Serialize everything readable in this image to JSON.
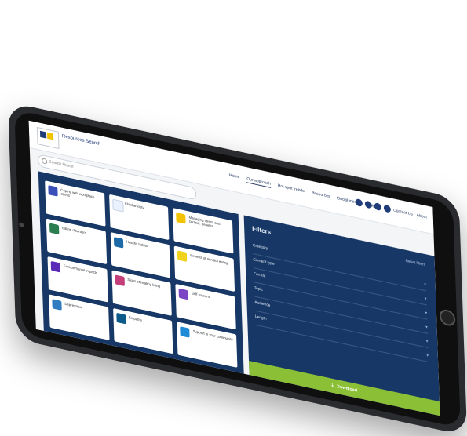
{
  "app": {
    "title": "Resources Search"
  },
  "search": {
    "placeholder": "Search Result"
  },
  "nav": {
    "items": [
      {
        "label": "Home"
      },
      {
        "label": "Our approach"
      },
      {
        "label": "Hot spot trends"
      },
      {
        "label": "Resources"
      },
      {
        "label": "Social media"
      },
      {
        "label": "Insights"
      }
    ],
    "links": {
      "contact": "Contact Us",
      "about": "About"
    }
  },
  "cards": [
    {
      "title": "Coping with workplace stress",
      "subtitle": "",
      "color": "#3b4fb8"
    },
    {
      "title": "Child anxiety",
      "subtitle": "",
      "color": "#eaf2ff"
    },
    {
      "title": "Managing stress and cortisol: benefits",
      "subtitle": "",
      "color": "#f3c300"
    },
    {
      "title": "Eating disorders",
      "subtitle": "",
      "color": "#2a7e4f"
    },
    {
      "title": "Healthy habits",
      "subtitle": "",
      "color": "#1d6aa8"
    },
    {
      "title": "Benefits of mindful eating",
      "subtitle": "",
      "color": "#f1d31e"
    },
    {
      "title": "Environmental impacts",
      "subtitle": "",
      "color": "#5b2bb8"
    },
    {
      "title": "Signs of healthy living",
      "subtitle": "",
      "color": "#c43f7a"
    },
    {
      "title": "Self-esteem",
      "subtitle": "",
      "color": "#7a46c3"
    },
    {
      "title": "Depression",
      "subtitle": "",
      "color": "#2f7bbf"
    },
    {
      "title": "Empathy",
      "subtitle": "",
      "color": "#0e5a8a"
    },
    {
      "title": "Support in your community",
      "subtitle": "",
      "color": "#1f8ad6"
    }
  ],
  "filters": {
    "title": "Filters",
    "reset": "Reset filters",
    "rows": [
      "Category",
      "Content type",
      "Format",
      "Topic",
      "Audience",
      "Length"
    ]
  },
  "download": {
    "label": "Download"
  }
}
